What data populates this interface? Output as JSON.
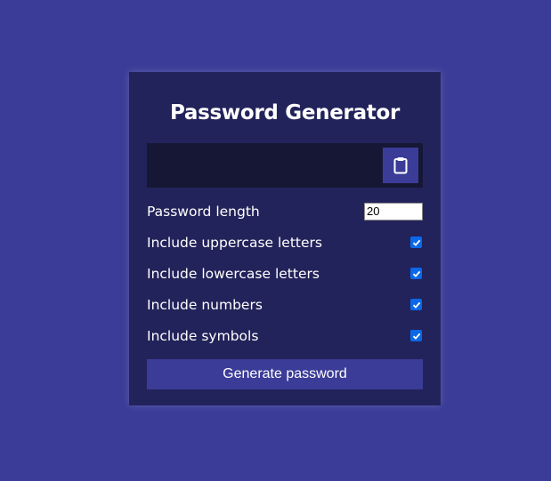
{
  "app": {
    "title": "Password Generator"
  },
  "result": {
    "value": "",
    "copy_icon": "clipboard-icon"
  },
  "settings": {
    "length": {
      "label": "Password length",
      "value": "20"
    },
    "uppercase": {
      "label": "Include uppercase letters",
      "checked": true
    },
    "lowercase": {
      "label": "Include lowercase letters",
      "checked": true
    },
    "numbers": {
      "label": "Include numbers",
      "checked": true
    },
    "symbols": {
      "label": "Include symbols",
      "checked": true
    }
  },
  "actions": {
    "generate_label": "Generate password"
  },
  "colors": {
    "background": "#3b3c98",
    "card": "#23235b",
    "result_bg": "#161735",
    "accent": "#3b3c98",
    "checkbox": "#0b68e8"
  }
}
